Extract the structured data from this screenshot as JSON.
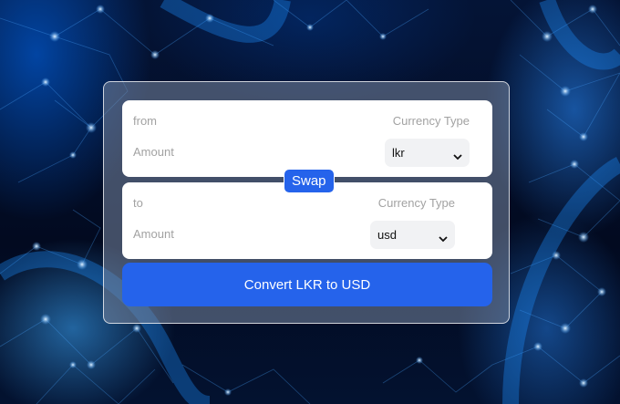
{
  "converter": {
    "from": {
      "label": "from",
      "amount_placeholder": "Amount",
      "currency_type_label": "Currency Type",
      "selected_currency": "lkr"
    },
    "swap_label": "Swap",
    "to": {
      "label": "to",
      "amount_placeholder": "Amount",
      "currency_type_label": "Currency Type",
      "selected_currency": "usd"
    },
    "convert_label": "Convert LKR to USD"
  },
  "colors": {
    "accent": "#2563eb",
    "panel": "#ffffff",
    "label_text": "#a2a2a2",
    "background": "#020c24"
  },
  "icons": {
    "dropdown": "chevron-down-icon"
  }
}
